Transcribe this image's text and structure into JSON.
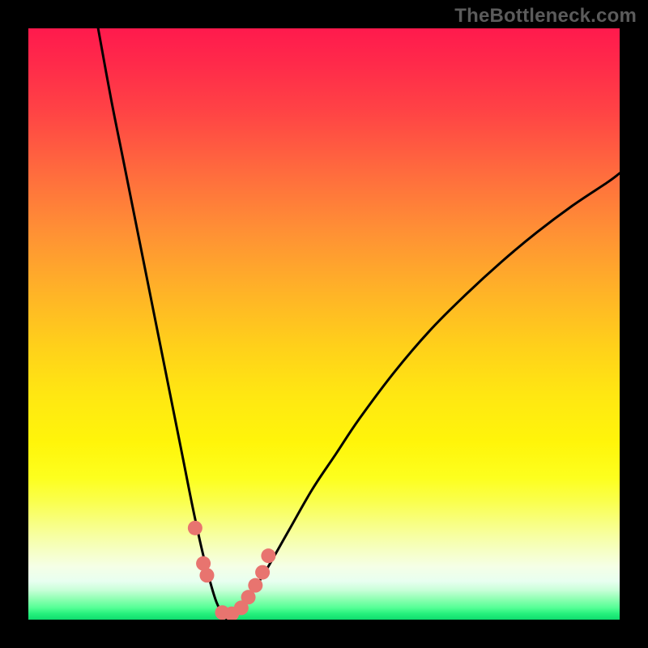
{
  "watermark": "TheBottleneck.com",
  "colors": {
    "frame": "#000000",
    "curve": "#000000",
    "marker": "#e8746f",
    "gradient_top": "#ff1a4d",
    "gradient_mid": "#fff50a",
    "gradient_bottom": "#0fdc6e"
  },
  "chart_data": {
    "type": "line",
    "title": "",
    "xlabel": "",
    "ylabel": "",
    "xlim": [
      0,
      100
    ],
    "ylim": [
      0,
      100
    ],
    "grid": false,
    "legend": false,
    "annotations": [],
    "series": [
      {
        "name": "left-branch",
        "x": [
          11.8,
          14,
          16,
          18,
          20,
          22,
          24,
          26,
          28,
          29.8,
          31.8,
          33.6
        ],
        "values": [
          100,
          88,
          78,
          68,
          58,
          48,
          38,
          28,
          18,
          10,
          3,
          0
        ]
      },
      {
        "name": "right-branch",
        "x": [
          33.6,
          36,
          38,
          40,
          44,
          48,
          52,
          56,
          62,
          68,
          74,
          80,
          86,
          92,
          98,
          100
        ],
        "values": [
          0,
          2,
          5,
          8,
          15,
          22,
          28,
          34,
          42,
          49,
          55,
          60.5,
          65.5,
          70,
          74,
          75.5
        ]
      }
    ],
    "markers": {
      "name": "highlight-dots",
      "x": [
        28.2,
        29.6,
        30.2,
        32.8,
        34.4,
        36.0,
        37.2,
        38.4,
        39.6,
        40.6
      ],
      "values": [
        15.5,
        9.5,
        7.5,
        1.2,
        1.0,
        2.0,
        3.8,
        5.8,
        8.0,
        10.8
      ],
      "radius_px": 9
    }
  }
}
